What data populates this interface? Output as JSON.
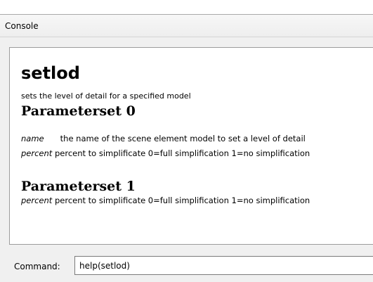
{
  "window": {
    "title": "Console"
  },
  "help": {
    "command_name": "setlod",
    "description": "sets the level of detail for a specified model",
    "parametersets": [
      {
        "heading": "Parameterset 0",
        "params": [
          {
            "name": "name",
            "text": "the name of the scene element model to set a level of detail"
          },
          {
            "name": "percent",
            "text": "percent to simplificate 0=full simplification 1=no simplification"
          }
        ]
      },
      {
        "heading": "Parameterset 1",
        "params": [
          {
            "name": "percent",
            "text": "percent to simplificate 0=full simplification 1=no simplification"
          }
        ]
      }
    ]
  },
  "command_bar": {
    "label": "Command:",
    "value": "help(setlod)"
  }
}
